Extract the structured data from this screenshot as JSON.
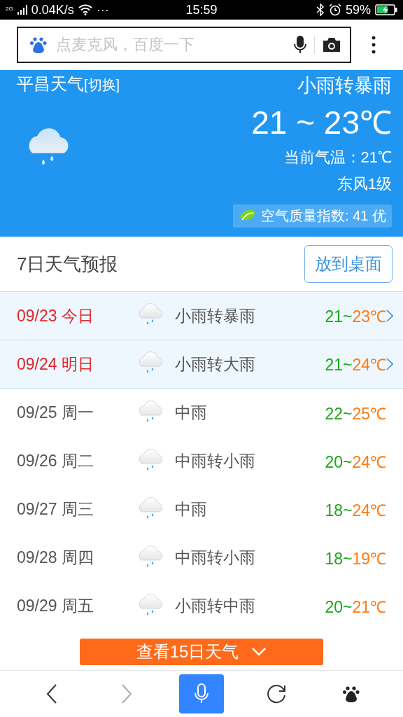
{
  "status_bar": {
    "network": "2G",
    "speed": "0.04K/s",
    "more": "···",
    "time": "15:59",
    "battery": "59%",
    "charging": true
  },
  "search": {
    "placeholder": "点麦克风，百度一下"
  },
  "weather": {
    "city": "平昌天气",
    "switch": "[切换]",
    "condition": "小雨转暴雨",
    "range": "21 ~ 23℃",
    "current": "当前气温：21℃",
    "wind": "东风1级",
    "aqi": "空气质量指数: 41 优"
  },
  "forecast": {
    "title": "7日天气预报",
    "button": "放到桌面",
    "days": [
      {
        "date": "09/23 今日",
        "condition": "小雨转暴雨",
        "low": "21~",
        "high": "23℃",
        "highlighted": true
      },
      {
        "date": "09/24 明日",
        "condition": "小雨转大雨",
        "low": "21~",
        "high": "24℃",
        "highlighted": true
      },
      {
        "date": "09/25 周一",
        "condition": "中雨",
        "low": "22~",
        "high": "25℃",
        "highlighted": false
      },
      {
        "date": "09/26 周二",
        "condition": "中雨转小雨",
        "low": "20~",
        "high": "24℃",
        "highlighted": false
      },
      {
        "date": "09/27 周三",
        "condition": "中雨",
        "low": "18~",
        "high": "24℃",
        "highlighted": false
      },
      {
        "date": "09/28 周四",
        "condition": "中雨转小雨",
        "low": "18~",
        "high": "19℃",
        "highlighted": false
      },
      {
        "date": "09/29 周五",
        "condition": "小雨转中雨",
        "low": "20~",
        "high": "21℃",
        "highlighted": false
      }
    ],
    "more_button": "查看15日天气"
  }
}
